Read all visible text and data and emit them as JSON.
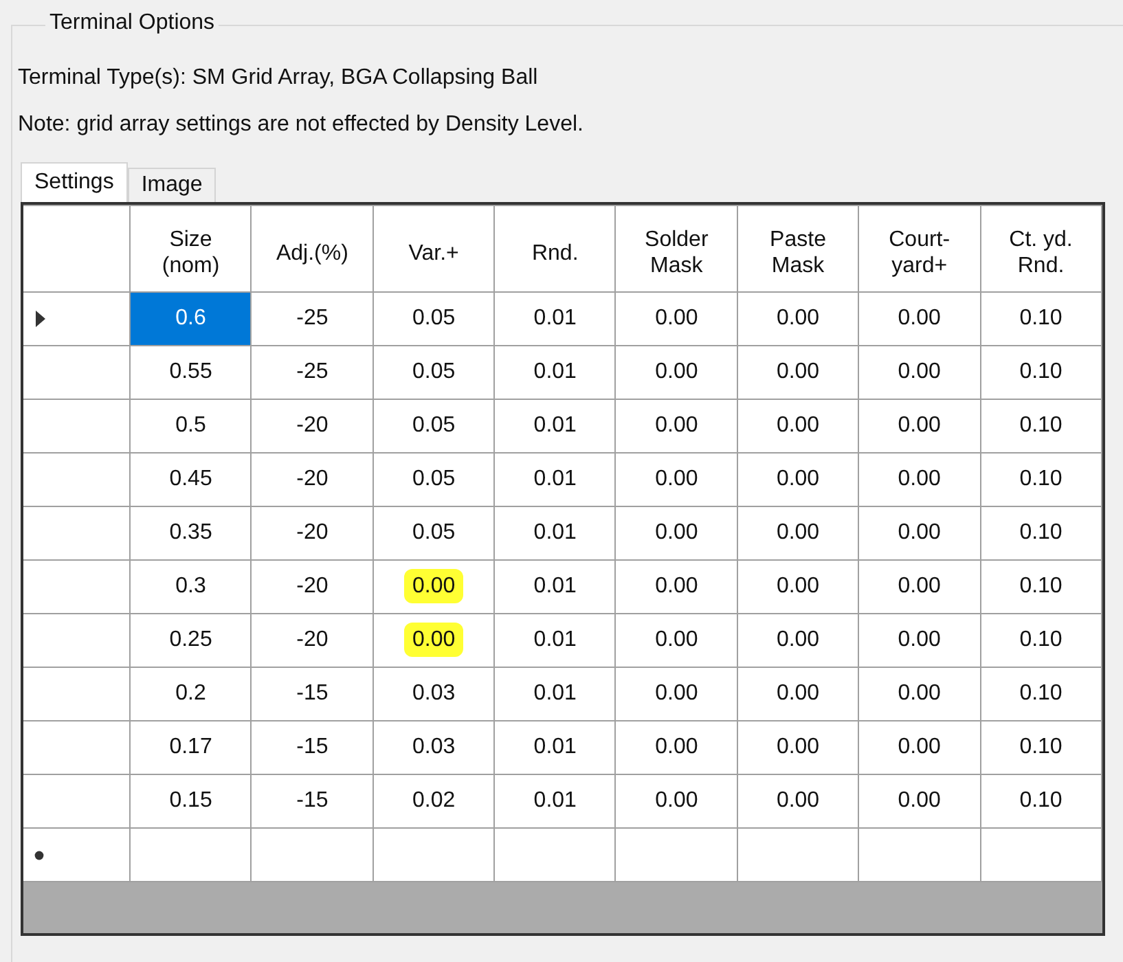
{
  "group": {
    "title": "Terminal Options"
  },
  "terminal_types": "Terminal Type(s): SM Grid Array, BGA Collapsing Ball",
  "note": "Note: grid array settings are not effected by Density Level.",
  "tabs": [
    {
      "label": "Settings",
      "selected": true
    },
    {
      "label": "Image",
      "selected": false
    }
  ],
  "table": {
    "columns": [
      "Size\n(nom)",
      "Adj.(%)",
      "Var.+",
      "Rnd.",
      "Solder\nMask",
      "Paste\nMask",
      "Court-\nyard+",
      "Ct. yd.\nRnd."
    ],
    "rows": [
      {
        "selected": true,
        "cells": [
          {
            "text": "0.6",
            "highlighted": false
          },
          {
            "text": "-25",
            "highlighted": false
          },
          {
            "text": "0.05",
            "highlighted": false
          },
          {
            "text": "0.01",
            "highlighted": false
          },
          {
            "text": "0.00",
            "highlighted": false
          },
          {
            "text": "0.00",
            "highlighted": false
          },
          {
            "text": "0.00",
            "highlighted": false
          },
          {
            "text": "0.10",
            "highlighted": false
          }
        ]
      },
      {
        "selected": false,
        "cells": [
          {
            "text": "0.55",
            "highlighted": false
          },
          {
            "text": "-25",
            "highlighted": false
          },
          {
            "text": "0.05",
            "highlighted": false
          },
          {
            "text": "0.01",
            "highlighted": false
          },
          {
            "text": "0.00",
            "highlighted": false
          },
          {
            "text": "0.00",
            "highlighted": false
          },
          {
            "text": "0.00",
            "highlighted": false
          },
          {
            "text": "0.10",
            "highlighted": false
          }
        ]
      },
      {
        "selected": false,
        "cells": [
          {
            "text": "0.5",
            "highlighted": false
          },
          {
            "text": "-20",
            "highlighted": false
          },
          {
            "text": "0.05",
            "highlighted": false
          },
          {
            "text": "0.01",
            "highlighted": false
          },
          {
            "text": "0.00",
            "highlighted": false
          },
          {
            "text": "0.00",
            "highlighted": false
          },
          {
            "text": "0.00",
            "highlighted": false
          },
          {
            "text": "0.10",
            "highlighted": false
          }
        ]
      },
      {
        "selected": false,
        "cells": [
          {
            "text": "0.45",
            "highlighted": false
          },
          {
            "text": "-20",
            "highlighted": false
          },
          {
            "text": "0.05",
            "highlighted": false
          },
          {
            "text": "0.01",
            "highlighted": false
          },
          {
            "text": "0.00",
            "highlighted": false
          },
          {
            "text": "0.00",
            "highlighted": false
          },
          {
            "text": "0.00",
            "highlighted": false
          },
          {
            "text": "0.10",
            "highlighted": false
          }
        ]
      },
      {
        "selected": false,
        "cells": [
          {
            "text": "0.35",
            "highlighted": false
          },
          {
            "text": "-20",
            "highlighted": false
          },
          {
            "text": "0.05",
            "highlighted": false
          },
          {
            "text": "0.01",
            "highlighted": false
          },
          {
            "text": "0.00",
            "highlighted": false
          },
          {
            "text": "0.00",
            "highlighted": false
          },
          {
            "text": "0.00",
            "highlighted": false
          },
          {
            "text": "0.10",
            "highlighted": false
          }
        ]
      },
      {
        "selected": false,
        "cells": [
          {
            "text": "0.3",
            "highlighted": false
          },
          {
            "text": "-20",
            "highlighted": false
          },
          {
            "text": "0.00",
            "highlighted": true
          },
          {
            "text": "0.01",
            "highlighted": false
          },
          {
            "text": "0.00",
            "highlighted": false
          },
          {
            "text": "0.00",
            "highlighted": false
          },
          {
            "text": "0.00",
            "highlighted": false
          },
          {
            "text": "0.10",
            "highlighted": false
          }
        ]
      },
      {
        "selected": false,
        "cells": [
          {
            "text": "0.25",
            "highlighted": false
          },
          {
            "text": "-20",
            "highlighted": false
          },
          {
            "text": "0.00",
            "highlighted": true
          },
          {
            "text": "0.01",
            "highlighted": false
          },
          {
            "text": "0.00",
            "highlighted": false
          },
          {
            "text": "0.00",
            "highlighted": false
          },
          {
            "text": "0.00",
            "highlighted": false
          },
          {
            "text": "0.10",
            "highlighted": false
          }
        ]
      },
      {
        "selected": false,
        "cells": [
          {
            "text": "0.2",
            "highlighted": false
          },
          {
            "text": "-15",
            "highlighted": false
          },
          {
            "text": "0.03",
            "highlighted": false
          },
          {
            "text": "0.01",
            "highlighted": false
          },
          {
            "text": "0.00",
            "highlighted": false
          },
          {
            "text": "0.00",
            "highlighted": false
          },
          {
            "text": "0.00",
            "highlighted": false
          },
          {
            "text": "0.10",
            "highlighted": false
          }
        ]
      },
      {
        "selected": false,
        "cells": [
          {
            "text": "0.17",
            "highlighted": false
          },
          {
            "text": "-15",
            "highlighted": false
          },
          {
            "text": "0.03",
            "highlighted": false
          },
          {
            "text": "0.01",
            "highlighted": false
          },
          {
            "text": "0.00",
            "highlighted": false
          },
          {
            "text": "0.00",
            "highlighted": false
          },
          {
            "text": "0.00",
            "highlighted": false
          },
          {
            "text": "0.10",
            "highlighted": false
          }
        ]
      },
      {
        "selected": false,
        "cells": [
          {
            "text": "0.15",
            "highlighted": false
          },
          {
            "text": "-15",
            "highlighted": false
          },
          {
            "text": "0.02",
            "highlighted": false
          },
          {
            "text": "0.01",
            "highlighted": false
          },
          {
            "text": "0.00",
            "highlighted": false
          },
          {
            "text": "0.00",
            "highlighted": false
          },
          {
            "text": "0.00",
            "highlighted": false
          },
          {
            "text": "0.10",
            "highlighted": false
          }
        ]
      }
    ]
  }
}
